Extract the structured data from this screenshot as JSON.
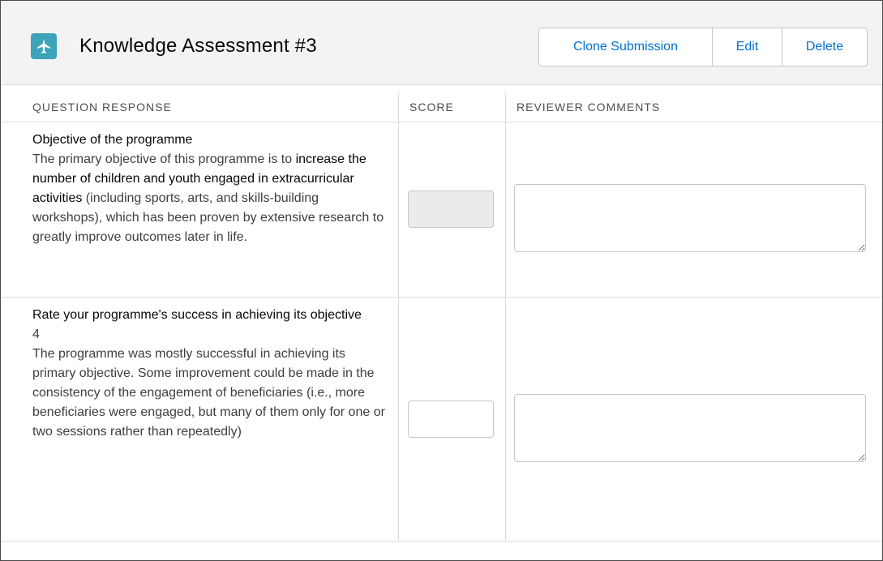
{
  "header": {
    "title": "Knowledge Assessment #3",
    "buttons": {
      "clone": "Clone Submission",
      "edit": "Edit",
      "delete": "Delete"
    }
  },
  "table": {
    "columns": [
      "QUESTION RESPONSE",
      "SCORE",
      "REVIEWER COMMENTS"
    ],
    "rows": [
      {
        "question": "Objective of the programme",
        "response_parts": [
          "The primary objective of this programme is to ",
          "increase the number of children and youth engaged in extracurricular activities",
          " (including sports, arts, and skills-building workshops), which has been proven by extensive research to greatly improve outcomes later in life."
        ],
        "score": "",
        "score_disabled": true,
        "comment": ""
      },
      {
        "question": "Rate your programme's success in achieving its objective",
        "rating": "4",
        "response": "The programme was mostly successful in achieving its primary objective. Some improvement could be made in the consistency of the engagement of beneficiaries (i.e., more beneficiaries were engaged, but many of them only for one or two sessions rather than repeatedly)",
        "score": "",
        "score_disabled": false,
        "comment": ""
      }
    ]
  },
  "colors": {
    "header_bg": "#f3f3f3",
    "icon_bg": "#3ca3b8",
    "link": "#0070d2",
    "border": "#dddbda",
    "disabled_input": "#ecebea"
  },
  "icons": {
    "app": "airplane-icon"
  }
}
